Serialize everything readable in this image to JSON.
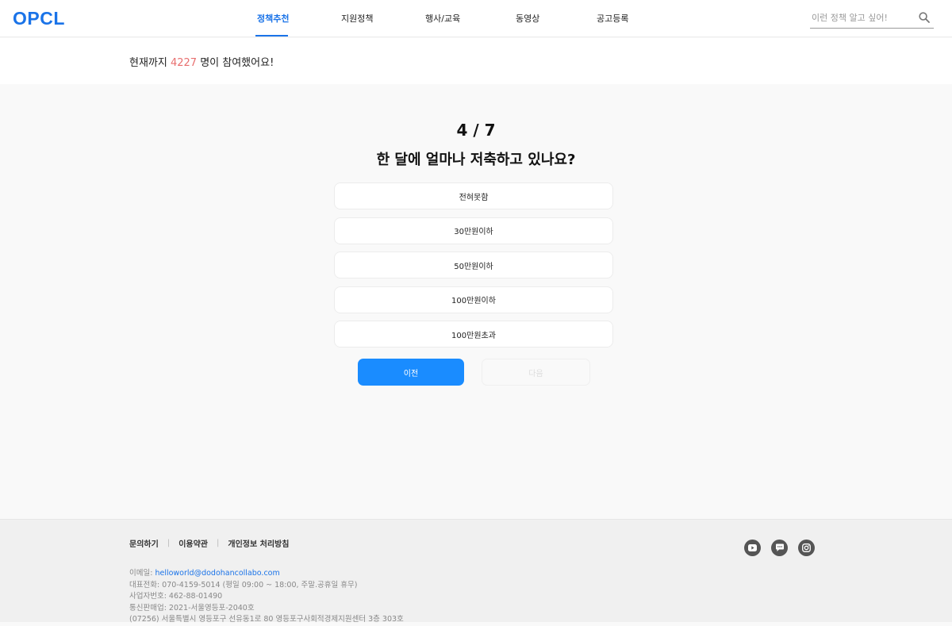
{
  "header": {
    "logo": "OPCL",
    "nav": [
      {
        "label": "정책추천",
        "active": true
      },
      {
        "label": "지원정책",
        "active": false
      },
      {
        "label": "행사/교육",
        "active": false
      },
      {
        "label": "동영상",
        "active": false
      },
      {
        "label": "공고등록",
        "active": false
      }
    ],
    "search_placeholder": "이런 정책 알고 싶어!"
  },
  "participation": {
    "prefix": "현재까지 ",
    "count": "4227",
    "suffix": " 명이 참여했어요!"
  },
  "survey": {
    "progress": "4 / 7",
    "question": "한 달에 얼마나 저축하고 있나요?",
    "options": [
      "전혀못함",
      "30만원이하",
      "50만원이하",
      "100만원이하",
      "100만원초과"
    ],
    "prev_label": "이전",
    "next_label": "다음"
  },
  "footer": {
    "links": [
      "문의하기",
      "이용약관",
      "개인정보 처리방침"
    ],
    "email_label": "이메일: ",
    "email": "helloworld@dodohancollabo.com",
    "phone": "대표전화: 070-4159-5014 (평일 09:00 ~ 18:00, 주말.공휴일 휴무)",
    "business_no": "사업자번호: 462-88-01490",
    "mail_order": "통신판매업: 2021-서울영등포-2040호",
    "address": "(07256) 서울특별시 영등포구 선유동1로 80 영등포구사회적경제지원센터 3층 303호",
    "social_icons": [
      "youtube-icon",
      "chat-icon",
      "instagram-icon"
    ]
  },
  "colors": {
    "accent": "#1a73e8",
    "button": "#1a8cff",
    "count": "#e86f6f"
  }
}
